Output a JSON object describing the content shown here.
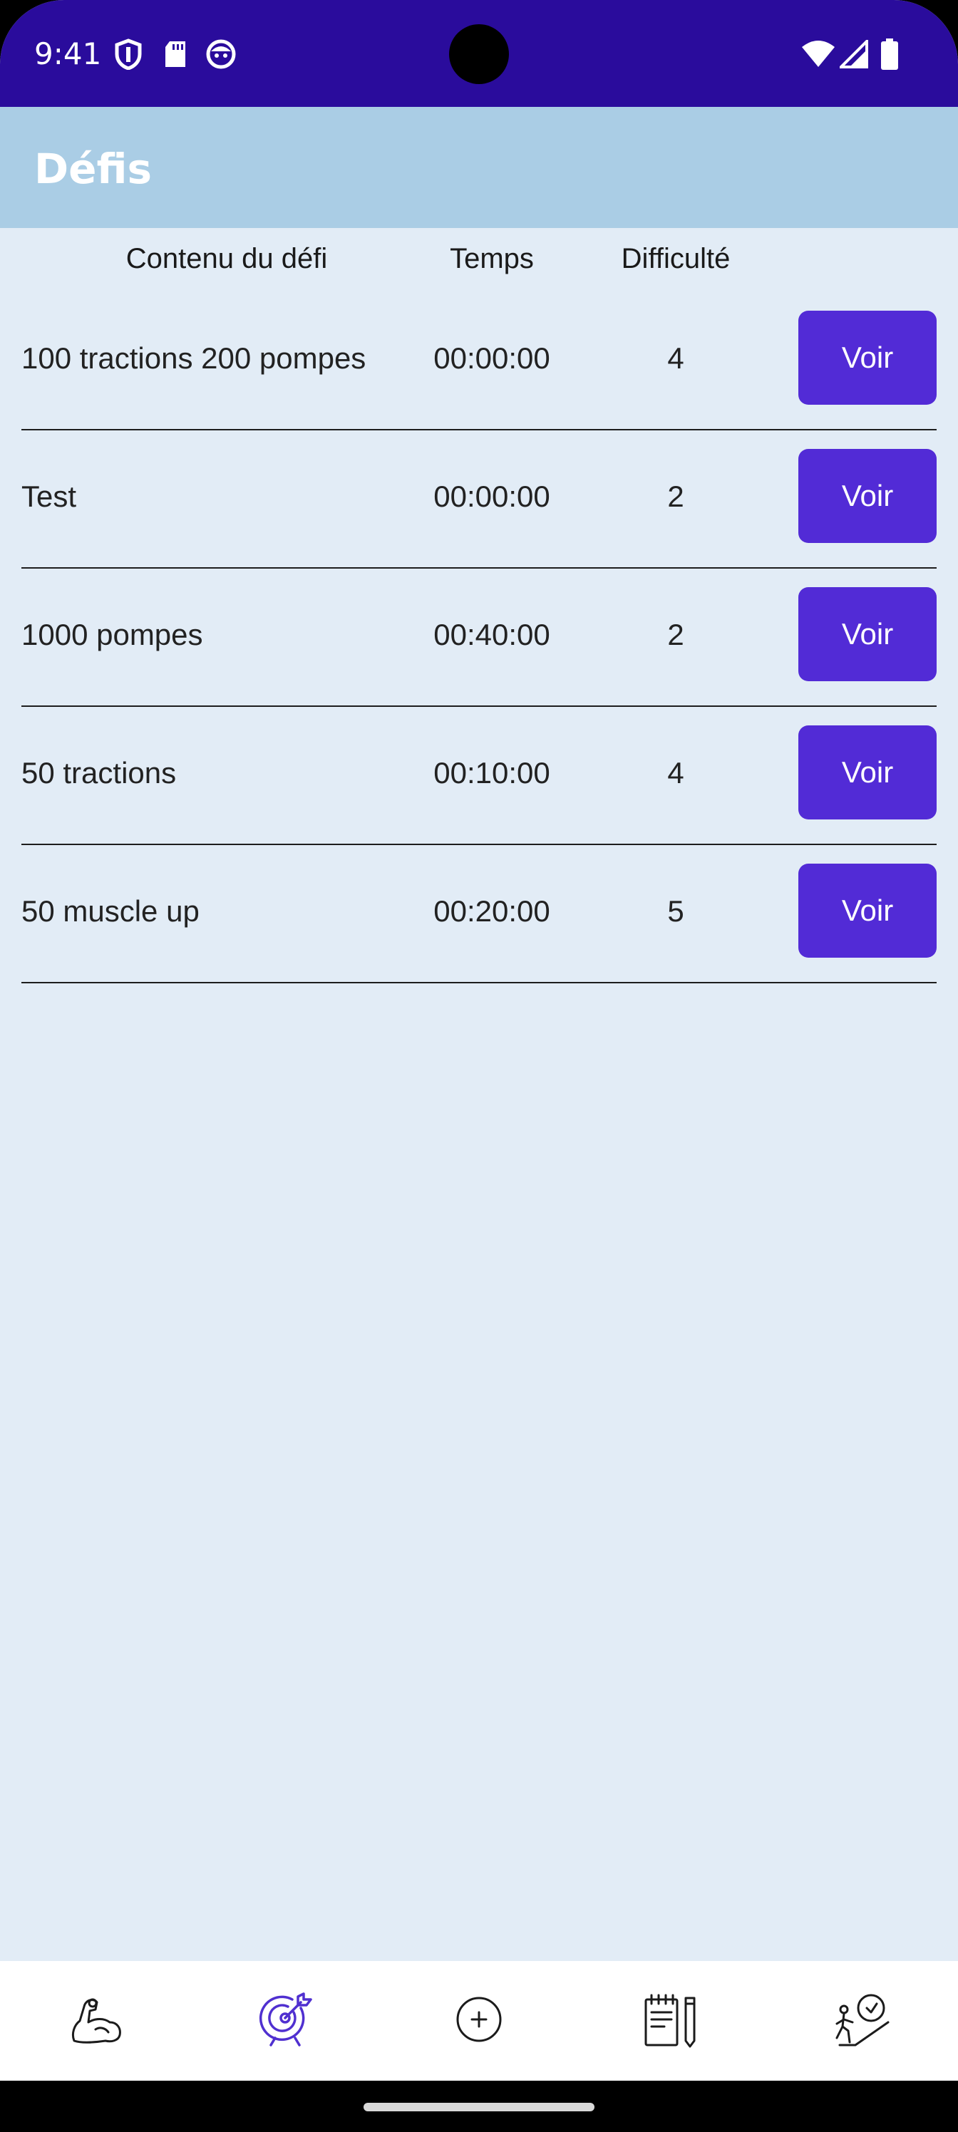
{
  "status_bar": {
    "time": "9:41",
    "icons_left": [
      "shield-icon",
      "sd-card-icon",
      "face-icon"
    ],
    "icons_right": [
      "wifi-icon",
      "signal-icon",
      "battery-icon"
    ],
    "background_color": "#2a0c9c"
  },
  "app_bar": {
    "title": "Défis",
    "background_color": "#aacde5"
  },
  "table": {
    "headers": {
      "content": "Contenu du défi",
      "time": "Temps",
      "difficulty": "Difficulté"
    },
    "rows": [
      {
        "content": "100 tractions 200 pompes",
        "time": "00:00:00",
        "difficulty": "4",
        "button": "Voir"
      },
      {
        "content": "Test",
        "time": "00:00:00",
        "difficulty": "2",
        "button": "Voir"
      },
      {
        "content": "1000 pompes",
        "time": "00:40:00",
        "difficulty": "2",
        "button": "Voir"
      },
      {
        "content": "50 tractions",
        "time": "00:10:00",
        "difficulty": "4",
        "button": "Voir"
      },
      {
        "content": "50 muscle up",
        "time": "00:20:00",
        "difficulty": "5",
        "button": "Voir"
      }
    ],
    "button_color": "#522bd6"
  },
  "bottom_nav": {
    "items": [
      {
        "icon": "flexed-arm-icon",
        "active": false
      },
      {
        "icon": "target-icon",
        "active": true
      },
      {
        "icon": "add-circle-icon",
        "active": false
      },
      {
        "icon": "notepad-pencil-icon",
        "active": false
      },
      {
        "icon": "person-stairs-icon",
        "active": false
      }
    ],
    "active_color": "#5030d0"
  }
}
